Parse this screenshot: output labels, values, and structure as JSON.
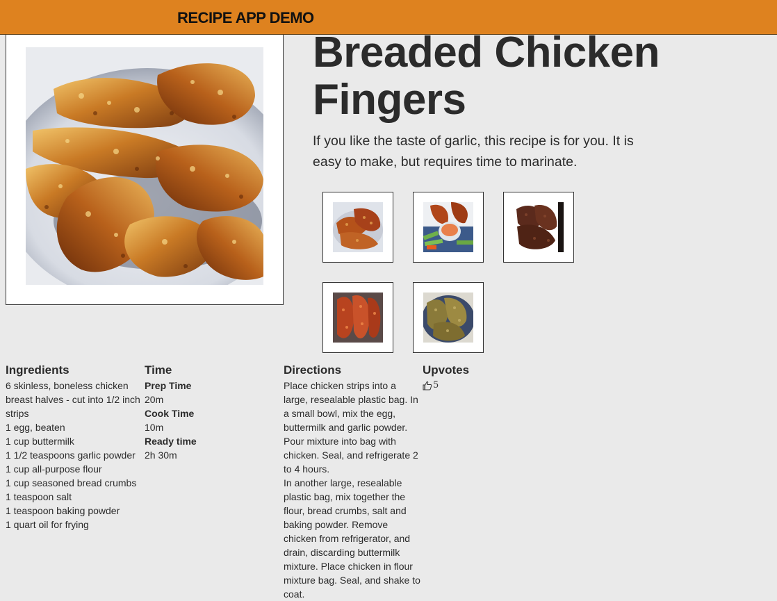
{
  "header": {
    "app_title": "RECIPE APP DEMO"
  },
  "recipe": {
    "title": "Breaded Chicken Fingers",
    "description": "If you like the taste of garlic, this recipe is for you. It is easy to make, but requires time to marinate."
  },
  "thumbnails": [
    {
      "icon": "chicken-wings-photo"
    },
    {
      "icon": "wings-with-dip-and-celery-photo"
    },
    {
      "icon": "dark-fried-chicken-photo"
    },
    {
      "icon": "spicy-glazed-chicken-photo"
    },
    {
      "icon": "baked-chicken-strips-photo"
    }
  ],
  "ingredients": {
    "heading": "Ingredients",
    "items": [
      "6 skinless, boneless chicken breast halves - cut into 1/2 inch strips",
      "1 egg, beaten",
      "1 cup buttermilk",
      "1 1/2 teaspoons garlic powder",
      "1 cup all-purpose flour",
      "1 cup seasoned bread crumbs",
      "1 teaspoon salt",
      "1 teaspoon baking powder",
      "1 quart oil for frying"
    ]
  },
  "time": {
    "heading": "Time",
    "prep_label": "Prep Time",
    "prep_value": "20m",
    "cook_label": "Cook Time",
    "cook_value": "10m",
    "ready_label": "Ready time",
    "ready_value": "2h 30m"
  },
  "directions": {
    "heading": "Directions",
    "steps": [
      "Place chicken strips into a large, resealable plastic bag. In a small bowl, mix the egg, buttermilk and garlic powder. Pour mixture into bag with chicken. Seal, and refrigerate 2 to 4 hours.",
      "In another large, resealable plastic bag, mix together the flour, bread crumbs, salt and baking powder. Remove chicken from refrigerator, and drain, discarding buttermilk mixture. Place chicken in flour mixture bag. Seal, and shake to coat."
    ]
  },
  "upvotes": {
    "heading": "Upvotes",
    "count": "5",
    "icon": "thumbs-up-icon"
  },
  "colors": {
    "header_bg": "#de821f",
    "page_bg": "#eaeaea",
    "text": "#2b2b2b"
  }
}
